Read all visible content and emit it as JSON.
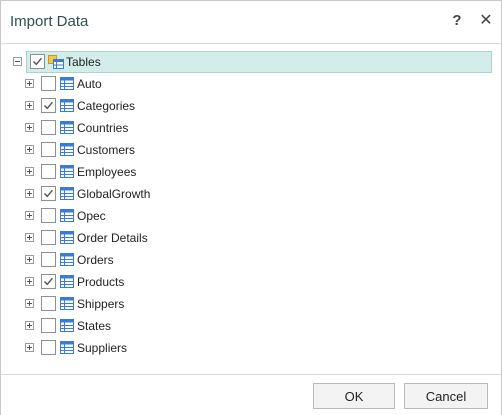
{
  "dialog": {
    "title": "Import Data",
    "help_glyph": "?",
    "close_glyph": "✕"
  },
  "tree": {
    "root": {
      "label": "Tables",
      "checked": true,
      "expanded": true,
      "icon": "tables-folder-icon"
    },
    "items": [
      {
        "label": "Auto",
        "checked": false
      },
      {
        "label": "Categories",
        "checked": true
      },
      {
        "label": "Countries",
        "checked": false
      },
      {
        "label": "Customers",
        "checked": false
      },
      {
        "label": "Employees",
        "checked": false
      },
      {
        "label": "GlobalGrowth",
        "checked": true
      },
      {
        "label": "Opec",
        "checked": false
      },
      {
        "label": "Order Details",
        "checked": false
      },
      {
        "label": "Orders",
        "checked": false
      },
      {
        "label": "Products",
        "checked": true
      },
      {
        "label": "Shippers",
        "checked": false
      },
      {
        "label": "States",
        "checked": false
      },
      {
        "label": "Suppliers",
        "checked": false
      }
    ]
  },
  "footer": {
    "ok_label": "OK",
    "cancel_label": "Cancel"
  },
  "colors": {
    "selection_bg": "#d3eeea",
    "title_text": "#2f4f4f",
    "table_icon": "#3a7bd5"
  }
}
